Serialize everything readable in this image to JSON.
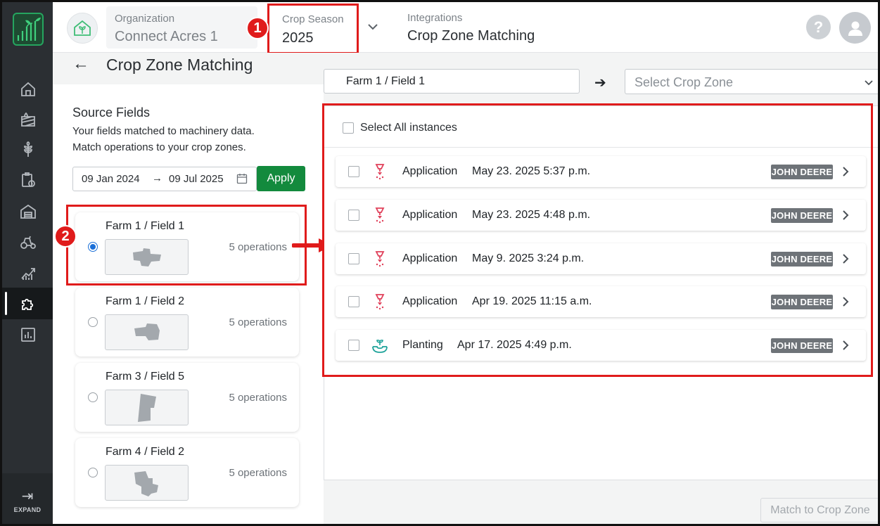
{
  "header": {
    "organization": {
      "label": "Organization",
      "value": "Connect Acres 1"
    },
    "crop_season": {
      "label": "Crop Season",
      "value": "2025"
    },
    "integrations": {
      "label": "Integrations",
      "value": "Crop Zone Matching"
    },
    "help_label": "?"
  },
  "annotations": {
    "badge1": "1",
    "badge2": "2"
  },
  "sidebar": {
    "items": [
      {
        "icon": "home-icon"
      },
      {
        "icon": "fields-icon"
      },
      {
        "icon": "crop-icon"
      },
      {
        "icon": "tasks-icon"
      },
      {
        "icon": "warehouse-icon"
      },
      {
        "icon": "equipment-icon"
      },
      {
        "icon": "trends-icon"
      },
      {
        "icon": "integrations-icon",
        "active": true
      },
      {
        "icon": "reports-icon"
      }
    ],
    "expand_label": "EXPAND"
  },
  "left": {
    "title": "Crop Zone Matching",
    "source_title": "Source Fields",
    "source_desc_line1": "Your fields matched to machinery data.",
    "source_desc_line2": "Match operations to your crop zones.",
    "date_from": "09 Jan 2024",
    "date_to": "09 Jul 2025",
    "apply_label": "Apply",
    "fields": [
      {
        "name": "Farm 1 / Field 1",
        "ops": "5 operations",
        "selected": true
      },
      {
        "name": "Farm 1 / Field 2",
        "ops": "5 operations",
        "selected": false
      },
      {
        "name": "Farm 3 / Field 5",
        "ops": "5 operations",
        "selected": false
      },
      {
        "name": "Farm 4 / Field 2",
        "ops": "5 operations",
        "selected": false
      }
    ]
  },
  "right": {
    "source_value": "Farm 1 / Field 1",
    "zone_placeholder": "Select Crop Zone",
    "select_all_label": "Select All instances",
    "operations": [
      {
        "type": "Application",
        "date": "May 23. 2025 5:37 p.m.",
        "brand": "JOHN DEERE"
      },
      {
        "type": "Application",
        "date": "May 23. 2025 4:48 p.m.",
        "brand": "JOHN DEERE"
      },
      {
        "type": "Application",
        "date": "May 9. 2025 3:24 p.m.",
        "brand": "JOHN DEERE"
      },
      {
        "type": "Application",
        "date": "Apr 19. 2025 11:15 a.m.",
        "brand": "JOHN DEERE"
      },
      {
        "type": "Planting",
        "date": "Apr 17. 2025 4:49 p.m.",
        "brand": "JOHN DEERE"
      }
    ],
    "match_button": "Match to Crop Zone"
  },
  "colors": {
    "accent_green": "#138a3d",
    "highlight_red": "#e01b1b",
    "application_icon": "#e0405a",
    "planting_icon": "#1fa39a",
    "sidebar_bg": "#2b2f33"
  }
}
